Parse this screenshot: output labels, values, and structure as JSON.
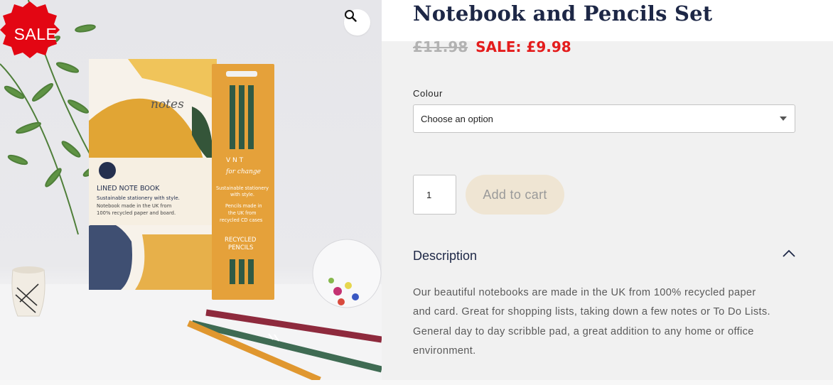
{
  "gallery": {
    "sale_badge": "SALE",
    "zoom_icon": "magnifier-icon",
    "product_image": {
      "notebook_brand_text": "notes",
      "notebook_label_title": "LINED NOTE BOOK",
      "notebook_label_line1": "Sustainable stationery with style.",
      "notebook_label_line2": "Notebook made in the UK from",
      "notebook_label_line3": "100% recycled paper and board.",
      "pencil_pack_brand": "V  N T",
      "pencil_pack_tagline": "for change",
      "pencil_pack_line1": "Sustainable stationery",
      "pencil_pack_line2": "with style.",
      "pencil_pack_line3": "Pencils made in",
      "pencil_pack_line4": "the UK from",
      "pencil_pack_line5": "recycled CD cases",
      "pencil_pack_title1": "RECYCLED",
      "pencil_pack_title2": "PENCILS"
    }
  },
  "product": {
    "title": "Notebook and Pencils Set",
    "old_price": "£11.98",
    "sale_price": "SALE: £9.98"
  },
  "variation": {
    "label": "Colour",
    "selected": "Choose an option"
  },
  "cart": {
    "quantity": "1",
    "add_button": "Add to cart"
  },
  "description": {
    "heading": "Description",
    "toggle_icon": "chevron-up-icon",
    "lines": [
      "Our beautiful notebooks are made in the UK from 100% recycled paper",
      "and card. Great for shopping lists, taking down a few notes or To Do Lists.",
      "General day to day scribble pad, a great addition to any home or office",
      "environment."
    ]
  },
  "colors": {
    "title": "#1d2746",
    "sale_red": "#e41c1c",
    "old_price_grey": "#b2b2b2",
    "button_beige": "#efe5d3",
    "badge_red": "#e30613"
  }
}
